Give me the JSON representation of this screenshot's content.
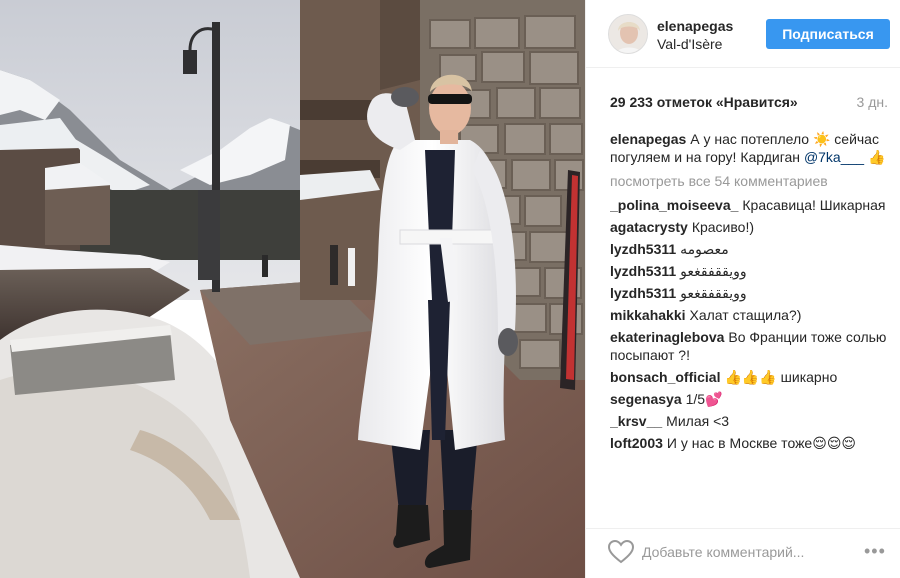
{
  "post": {
    "username": "elenapegas",
    "location": "Val-d'Isère",
    "follow_label": "Подписаться",
    "likes": "29 233 отметок «Нравится»",
    "time_ago": "3 дн."
  },
  "caption": {
    "author": "elenapegas",
    "text": "А у нас потеплело ☀️ сейчас погуляем и на гору! Кардиган",
    "mention": "@7ka___ 👍"
  },
  "view_all_comments": "посмотреть все 54 комментариев",
  "comments": [
    {
      "author": "_polina_moiseeva_",
      "text": "Красавица! Шикарная"
    },
    {
      "author": "agatacrysty",
      "text": "Красиво!)"
    },
    {
      "author": "lyzdh5311",
      "text": "معصومه"
    },
    {
      "author": "lyzdh5311",
      "text": "وويققفقغعو"
    },
    {
      "author": "lyzdh5311",
      "text": "وويققفقغعو"
    },
    {
      "author": "mikkahakki",
      "text": "Халат стащила?)"
    },
    {
      "author": "ekaterinaglebova",
      "text": "Во Франции тоже солью посыпают ?!"
    },
    {
      "author": "bonsach_official",
      "text": "👍👍👍 шикарно"
    },
    {
      "author": "segenasya",
      "text": "1/5💕"
    },
    {
      "author": "_krsv__",
      "text": "Милая <3"
    },
    {
      "author": "loft2003",
      "text": "И у нас в Москве тоже😌😌😌"
    }
  ],
  "add_comment": {
    "placeholder": "Добавьте комментарий..."
  },
  "icons": {
    "like": "heart-icon",
    "more": "more-options-icon"
  },
  "colors": {
    "accent": "#3897f0",
    "text": "#262626",
    "muted": "#999999"
  }
}
